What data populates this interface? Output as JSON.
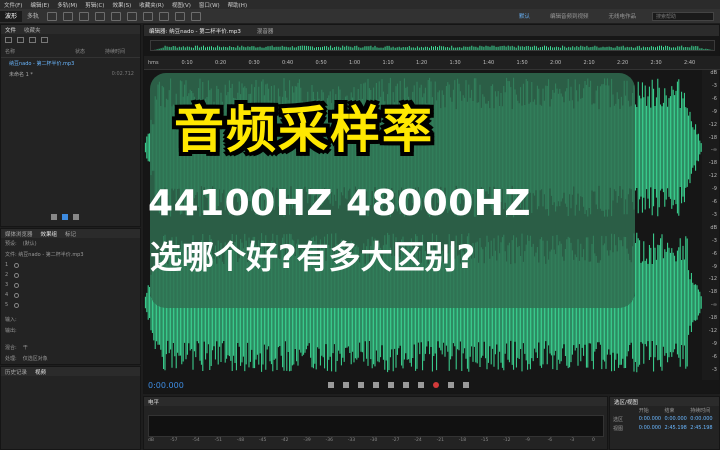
{
  "menu": [
    "文件(F)",
    "编辑(E)",
    "多轨(M)",
    "剪辑(C)",
    "效果(S)",
    "收藏夹(R)",
    "视图(V)",
    "窗口(W)",
    "帮助(H)"
  ],
  "toolbar": {
    "waveform_label": "波形",
    "multitrack_label": "多轨",
    "workspaces": [
      "默认",
      "编辑音频到视频",
      "无线电作品"
    ],
    "search_placeholder": "搜索帮助"
  },
  "files_panel": {
    "tabs": [
      "文件",
      "收藏夹"
    ],
    "columns": [
      "名称",
      "状态",
      "持续时间"
    ],
    "items": [
      {
        "name": "纳豆nado - 第二杯半价.mp3",
        "duration": "2:45.198",
        "selected": true
      },
      {
        "name": "未命名 1 *",
        "duration": "0:02.712",
        "selected": false
      }
    ]
  },
  "effects_panel": {
    "tabs": [
      "媒体浏览器",
      "效果组",
      "标记"
    ],
    "preset_label": "预设:",
    "preset_value": "(默认)",
    "file_label": "文件: 纳豆nado - 第二杯半价.mp3",
    "slots": [
      "1",
      "2",
      "3",
      "4",
      "5"
    ],
    "input_label": "输入:",
    "output_label": "输出:",
    "mix_label": "混合:",
    "mix_value": "干",
    "process_label": "处理:",
    "process_value": "仅选区对象"
  },
  "history_panel": {
    "tabs": [
      "历史记录",
      "视频"
    ]
  },
  "editor": {
    "tab_label": "编辑器: 纳豆nado - 第二杯半价.mp3",
    "mixer_label": "混音器",
    "time_ticks": [
      "hms",
      "0:10",
      "0:20",
      "0:30",
      "0:40",
      "0:50",
      "1:00",
      "1:10",
      "1:20",
      "1:30",
      "1:40",
      "1:50",
      "2:00",
      "2:10",
      "2:20",
      "2:30",
      "2:40"
    ],
    "db_ticks": [
      "dB",
      "-3",
      "-6",
      "-9",
      "-12",
      "-18",
      "-∞",
      "-18",
      "-12",
      "-9",
      "-6",
      "-3",
      "dB",
      "-3",
      "-6",
      "-9",
      "-12",
      "-18",
      "-∞",
      "-18",
      "-12",
      "-9",
      "-6",
      "-3"
    ],
    "timecode": "0:00.000"
  },
  "levels_panel": {
    "title": "电平",
    "ticks": [
      "dB",
      "-57",
      "-54",
      "-51",
      "-48",
      "-45",
      "-42",
      "-39",
      "-36",
      "-33",
      "-30",
      "-27",
      "-24",
      "-21",
      "-18",
      "-15",
      "-12",
      "-9",
      "-6",
      "-3",
      "0"
    ]
  },
  "selection_view": {
    "title": "选区/视图",
    "headers": [
      "",
      "开始",
      "结束",
      "持续时间"
    ],
    "rows": [
      {
        "label": "选区",
        "start": "0:00.000",
        "end": "0:00.000",
        "dur": "0:00.000"
      },
      {
        "label": "视图",
        "start": "0:00.000",
        "end": "2:45.198",
        "dur": "2:45.198"
      }
    ]
  },
  "overlay": {
    "title": "音频采样率",
    "line1": "44100HZ 48000HZ",
    "line2": "选哪个好?有多大区别?"
  },
  "colors": {
    "waveform": "#3ddc97",
    "accent": "#3d8be0",
    "title_yellow": "#ffe800"
  }
}
